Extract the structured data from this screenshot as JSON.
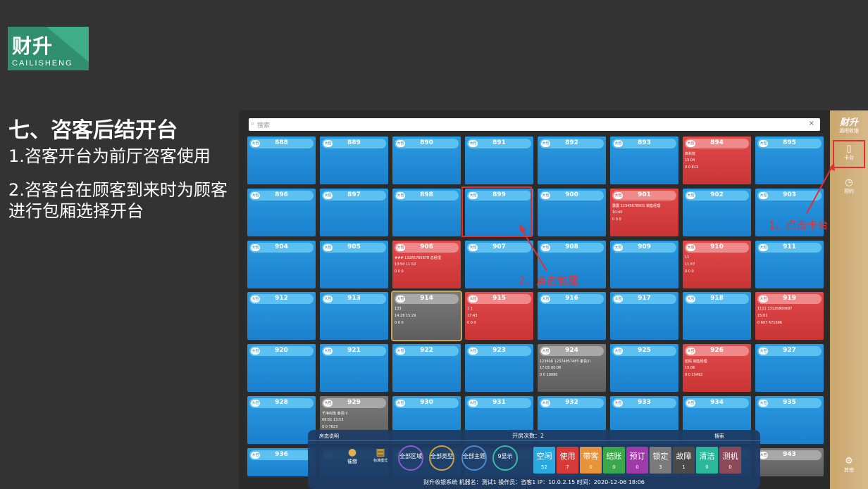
{
  "logo": {
    "big": "财升",
    "small": "CAILISHENG"
  },
  "slide": {
    "title": "七、咨客后结开台",
    "point1": "1.咨客开台为前厅咨客使用",
    "point2": "2.咨客台在顾客到来时为顾客进行包厢选择开台"
  },
  "search": {
    "placeholder": "搜索",
    "clear": "×"
  },
  "side": {
    "brand": "财升",
    "sub": "酒吧收银",
    "card_label": "卡台",
    "reserve_label": "预约",
    "other_label": "其他"
  },
  "size_badge": "大包",
  "tiles": [
    {
      "n": "888",
      "s": "blue"
    },
    {
      "n": "889",
      "s": "blue"
    },
    {
      "n": "890",
      "s": "blue"
    },
    {
      "n": "891",
      "s": "blue"
    },
    {
      "n": "892",
      "s": "blue"
    },
    {
      "n": "893",
      "s": "blue"
    },
    {
      "n": "894",
      "s": "red",
      "l": [
        "高科技",
        "15:04",
        "0      0      813"
      ]
    },
    {
      "n": "895",
      "s": "blue"
    },
    {
      "n": "896",
      "s": "blue"
    },
    {
      "n": "897",
      "s": "blue"
    },
    {
      "n": "898",
      "s": "blue"
    },
    {
      "n": "899",
      "s": "blue"
    },
    {
      "n": "900",
      "s": "blue"
    },
    {
      "n": "901",
      "s": "red",
      "l": [
        "露露    12345678901 销售经理",
        "10:40",
        "0         0         0"
      ]
    },
    {
      "n": "902",
      "s": "blue"
    },
    {
      "n": "903",
      "s": "blue"
    },
    {
      "n": "904",
      "s": "blue"
    },
    {
      "n": "905",
      "s": "blue"
    },
    {
      "n": "906",
      "s": "red",
      "l": [
        "###    13265785678  总经理",
        "13:50        11:52",
        "0         0         0"
      ]
    },
    {
      "n": "907",
      "s": "blue"
    },
    {
      "n": "908",
      "s": "blue"
    },
    {
      "n": "909",
      "s": "blue"
    },
    {
      "n": "910",
      "s": "red",
      "l": [
        "11",
        "11:57",
        "0         0         0"
      ]
    },
    {
      "n": "911",
      "s": "blue"
    },
    {
      "n": "912",
      "s": "blue"
    },
    {
      "n": "913",
      "s": "blue"
    },
    {
      "n": "914",
      "s": "gray",
      "l": [
        "133",
        "14:28        15:29",
        "0         0         0"
      ]
    },
    {
      "n": "915",
      "s": "red",
      "l": [
        "1          1",
        "17:43",
        "0         0         0"
      ]
    },
    {
      "n": "916",
      "s": "blue"
    },
    {
      "n": "917",
      "s": "blue"
    },
    {
      "n": "918",
      "s": "blue"
    },
    {
      "n": "919",
      "s": "red",
      "l": [
        "1111    13125800697",
        "15:01",
        "0        607     671696"
      ]
    },
    {
      "n": "920",
      "s": "blue"
    },
    {
      "n": "921",
      "s": "blue"
    },
    {
      "n": "922",
      "s": "blue"
    },
    {
      "n": "923",
      "s": "blue"
    },
    {
      "n": "924",
      "s": "gray",
      "l": [
        "123456  12374857485  秦贵川",
        "17:05        00:06",
        "0         0       10080"
      ]
    },
    {
      "n": "925",
      "s": "blue"
    },
    {
      "n": "926",
      "s": "red",
      "l": [
        "密码               销售经理",
        "15:06",
        "0         0       15492"
      ]
    },
    {
      "n": "927",
      "s": "blue"
    },
    {
      "n": "928",
      "s": "blue"
    },
    {
      "n": "929",
      "s": "gray",
      "l": [
        "千净利落            秦贵川",
        "09:51        13:53",
        "0         0        7623"
      ]
    },
    {
      "n": "930",
      "s": "blue"
    },
    {
      "n": "931",
      "s": "blue"
    },
    {
      "n": "932",
      "s": "blue"
    },
    {
      "n": "933",
      "s": "blue"
    },
    {
      "n": "934",
      "s": "blue"
    },
    {
      "n": "935",
      "s": "blue"
    },
    {
      "n": "936",
      "s": "blue"
    },
    {
      "n": "",
      "s": "blue"
    },
    {
      "n": "",
      "s": "blue"
    },
    {
      "n": "",
      "s": "blue"
    },
    {
      "n": "",
      "s": "blue"
    },
    {
      "n": "",
      "s": "blue"
    },
    {
      "n": "",
      "s": "blue"
    },
    {
      "n": "943",
      "s": "gray"
    }
  ],
  "bottom": {
    "left_hint": "房态说明",
    "open_count": "开房次数：2",
    "search": "搜索",
    "cashier": "催缴",
    "std_mode": "标准模式",
    "filters": [
      "全部区域",
      "全部类型",
      "全部主题",
      "9显示"
    ],
    "status": [
      {
        "label": "空闲",
        "count": "52",
        "color": "#2aa8e0"
      },
      {
        "label": "使用",
        "count": "7",
        "color": "#d83a3a"
      },
      {
        "label": "带客",
        "count": "0",
        "color": "#e8933a"
      },
      {
        "label": "结账",
        "count": "0",
        "color": "#3aa84a"
      },
      {
        "label": "预订",
        "count": "0",
        "color": "#a03aa8"
      },
      {
        "label": "锁定",
        "count": "3",
        "color": "#7a7a7a"
      },
      {
        "label": "故障",
        "count": "1",
        "color": "#4a4a4a"
      },
      {
        "label": "清洁",
        "count": "0",
        "color": "#2ab89a"
      },
      {
        "label": "测机",
        "count": "0",
        "color": "#8a4a5a"
      }
    ],
    "footer": "财升收银系统      机器名：测试1    操作员：咨客1    IP：10.0.2.15    时间：2020-12-06 18:06"
  },
  "annotations": {
    "step1": "1、点击卡台",
    "step2": "2、点击包厢"
  },
  "colors": {
    "accent_red": "#e83030",
    "tile_blue": "#1b7fcd",
    "side_gold": "#c9a66c"
  }
}
